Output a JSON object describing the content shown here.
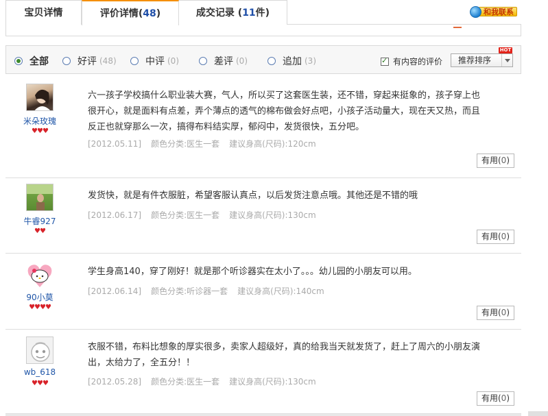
{
  "tabs": [
    {
      "label": "宝贝详情",
      "count": ""
    },
    {
      "label": "评价详情(",
      "count": "48",
      "suffix": ")"
    },
    {
      "label": "成交记录 (",
      "count": "11",
      "suffix": "件)"
    }
  ],
  "contact_label": "和我联系",
  "filters": {
    "all": "全部",
    "good": "好评",
    "good_count": "(48)",
    "medium": "中评",
    "medium_count": "(0)",
    "bad": "差评",
    "bad_count": "(0)",
    "append": "追加",
    "append_count": "(3)",
    "with_content": "有内容的评价",
    "sort": "推荐排序",
    "hot_badge": "HOT"
  },
  "reviews": [
    {
      "user": "米朵玫瑰",
      "hearts": "♥♥♥",
      "text": "六一孩子学校搞什么职业装大赛，气人，所以买了这套医生装，还不错，穿起来挺象的，孩子穿上也很开心，就是面料有点差，弄个薄点的透气的棉布做会好点吧，小孩子活动量大，现在天又热，而且反正也就穿那么一次，搞得布料结实厚，郁闷中，发货很快，五分吧。",
      "date": "[2012.05.11]",
      "color": "颜色分类:医生一套",
      "size": "建议身高(尺码):120cm",
      "helpful": "有用(",
      "helpful_count": "0",
      "helpful_end": ")"
    },
    {
      "user": "牛睿927",
      "hearts": "♥♥",
      "text": "发货快，就是有件衣服脏，希望客服认真点，以后发货注意点哦。其他还是不错的哦",
      "date": "[2012.06.17]",
      "color": "颜色分类:医生一套",
      "size": "建议身高(尺码):130cm",
      "helpful": "有用(",
      "helpful_count": "0",
      "helpful_end": ")"
    },
    {
      "user": "90小莫",
      "hearts": "♥♥♥♥",
      "text": "学生身高140，穿了刚好！就是那个听诊器实在太小了。。。幼儿园的小朋友可以用。",
      "date": "[2012.06.14]",
      "color": "颜色分类:听诊器一套",
      "size": "建议身高(尺码):140cm",
      "helpful": "有用(",
      "helpful_count": "0",
      "helpful_end": ")"
    },
    {
      "user": "wb_618",
      "hearts": "♥♥♥",
      "text": "衣服不错，布料比想象的厚实很多，卖家人超级好，真的给我当天就发货了，赶上了周六的小朋友演出，太给力了，全五分！！",
      "date": "[2012.05.28]",
      "color": "颜色分类:医生一套",
      "size": "建议身高(尺码):130cm",
      "helpful": "有用(",
      "helpful_count": "0",
      "helpful_end": ")"
    }
  ]
}
